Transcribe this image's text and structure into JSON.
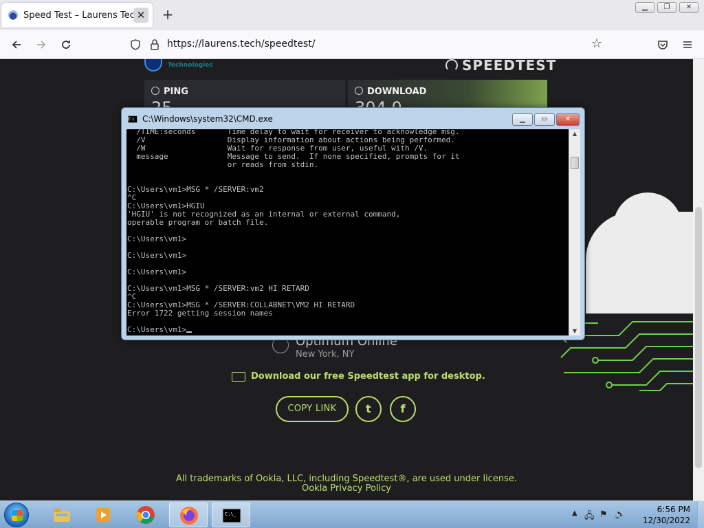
{
  "browser": {
    "tab_title": "Speed Test – Laurens Technologies",
    "tab_close": "✕",
    "new_tab": "+",
    "url": "https://laurens.tech/speedtest/",
    "window_controls": [
      "▁",
      "❐",
      "✕"
    ]
  },
  "page": {
    "brand_sub": "Technologies",
    "speedtest_logo": "SPEEDTEST",
    "ping_label": "PING",
    "ping_value": "25",
    "download_label": "DOWNLOAD",
    "download_value": "304.0",
    "isp_name": "Optimum Online",
    "isp_location": "New York, NY",
    "app_promo": "Download our free Speedtest app for desktop.",
    "copy_link": "COPY LINK",
    "twitter": "t",
    "facebook": "f",
    "footer_trademark": "All trademarks of Ookla, LLC, including Speedtest®, are used under license.",
    "footer_privacy": "Ookla Privacy Policy"
  },
  "cmd": {
    "title": "C:\\Windows\\system32\\CMD.exe",
    "lines": [
      "  /TIME:seconds       Time delay to wait for receiver to acknowledge msg.",
      "  /V                  Display information about actions being performed.",
      "  /W                  Wait for response from user, useful with /V.",
      "  message             Message to send.  If none specified, prompts for it",
      "                      or reads from stdin.",
      "",
      "",
      "C:\\Users\\vm1>MSG * /SERVER:vm2",
      "^C",
      "C:\\Users\\vm1>HGIU",
      "'HGIU' is not recognized as an internal or external command,",
      "operable program or batch file.",
      "",
      "C:\\Users\\vm1>",
      "",
      "C:\\Users\\vm1>",
      "",
      "C:\\Users\\vm1>",
      "",
      "C:\\Users\\vm1>MSG * /SERVER:vm2 HI RETARD",
      "^C",
      "C:\\Users\\vm1>MSG * /SERVER:COLLABNET\\VM2 HI RETARD",
      "Error 1722 getting session names",
      ""
    ],
    "prompt": "C:\\Users\\vm1>"
  },
  "taskbar": {
    "time": "6:56 PM",
    "date": "12/30/2022"
  }
}
